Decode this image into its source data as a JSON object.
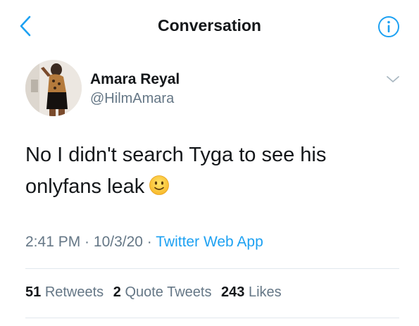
{
  "header": {
    "title": "Conversation",
    "back_icon": "chevron-left-icon",
    "info_icon": "info-circle-icon"
  },
  "tweet": {
    "author": {
      "display_name": "Amara Reyal",
      "handle": "@HilmAmara"
    },
    "text_line1": "No I didn't search Tyga to see his",
    "text_line2": "onlyfans leak",
    "emoji": "slightly-smiling-face-emoji",
    "time": "2:41 PM",
    "sep1": " · ",
    "date": "10/3/20",
    "sep2": " · ",
    "source": "Twitter Web App"
  },
  "stats": {
    "retweets_count": "51",
    "retweets_label": "Retweets",
    "quotes_count": "2",
    "quotes_label": "Quote Tweets",
    "likes_count": "243",
    "likes_label": "Likes"
  },
  "colors": {
    "accent": "#1da1f2",
    "secondary_text": "#657786",
    "primary_text": "#14171a",
    "divider": "#e1e8ed"
  }
}
